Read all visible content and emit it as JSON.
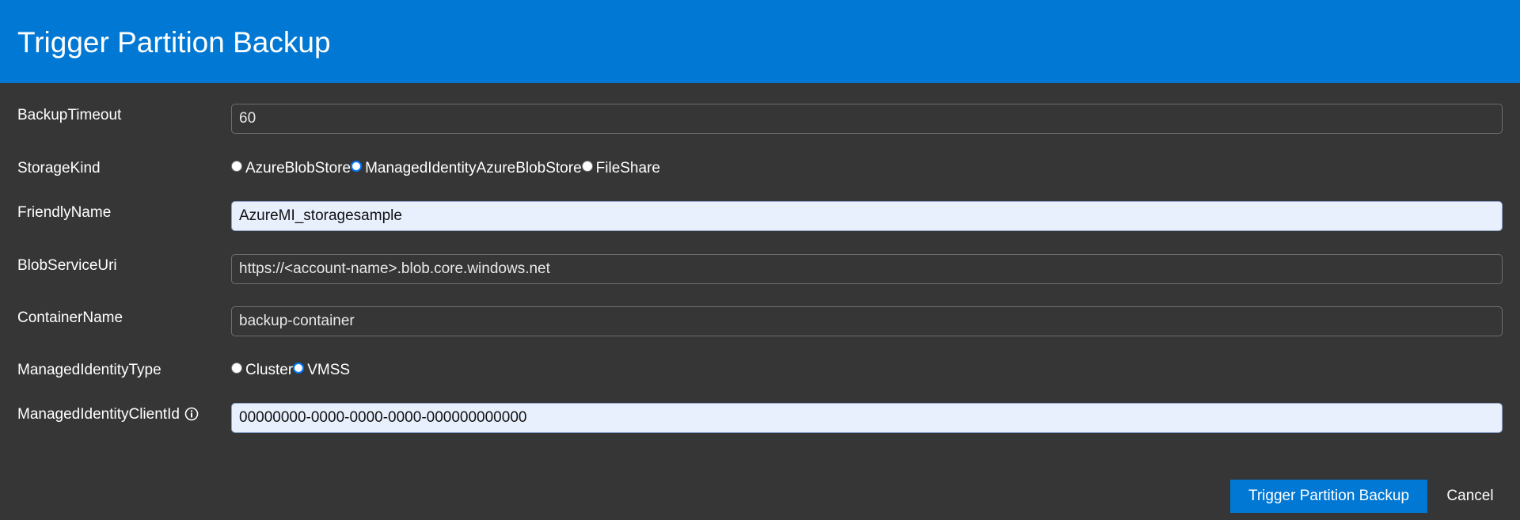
{
  "dialog": {
    "title": "Trigger Partition Backup"
  },
  "form": {
    "backup_timeout": {
      "label": "BackupTimeout",
      "value": "60"
    },
    "storage_kind": {
      "label": "StorageKind",
      "options": [
        {
          "label": "AzureBlobStore",
          "checked": false
        },
        {
          "label": "ManagedIdentityAzureBlobStore",
          "checked": true
        },
        {
          "label": "FileShare",
          "checked": false
        }
      ]
    },
    "friendly_name": {
      "label": "FriendlyName",
      "value": "AzureMI_storagesample"
    },
    "blob_service_uri": {
      "label": "BlobServiceUri",
      "value": "https://<account-name>.blob.core.windows.net"
    },
    "container_name": {
      "label": "ContainerName",
      "value": "backup-container"
    },
    "managed_identity_type": {
      "label": "ManagedIdentityType",
      "options": [
        {
          "label": "Cluster",
          "checked": false
        },
        {
          "label": "VMSS",
          "checked": true
        }
      ]
    },
    "managed_identity_client_id": {
      "label": "ManagedIdentityClientId",
      "value": "00000000-0000-0000-0000-000000000000",
      "icon": "info-icon"
    }
  },
  "footer": {
    "submit_label": "Trigger Partition Backup",
    "cancel_label": "Cancel"
  },
  "colors": {
    "accent": "#0078d4",
    "background": "#363636",
    "autofill_field": "#e8f0fe"
  }
}
